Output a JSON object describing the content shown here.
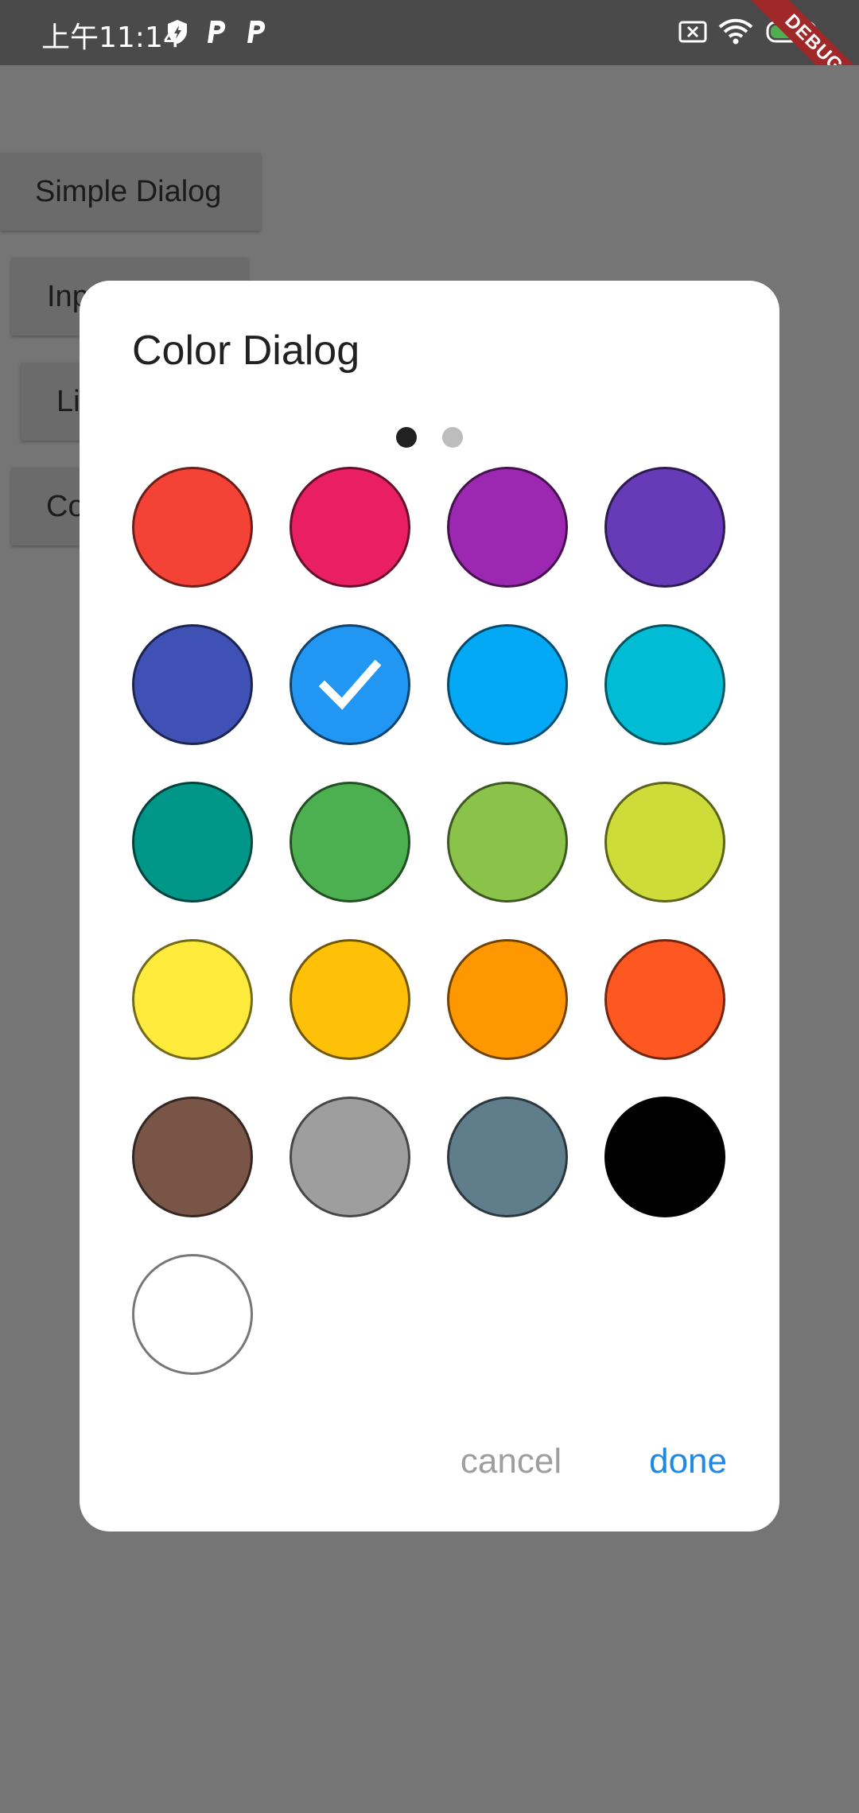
{
  "status_bar": {
    "time": "上午11:14",
    "debug_label": "DEBUG"
  },
  "background_buttons": [
    "Simple Dialog",
    "Inp",
    "Li",
    "Co"
  ],
  "dialog": {
    "title": "Color Dialog",
    "page_index": 1,
    "page_count": 2,
    "selected_index": 5,
    "swatches": [
      "#F44336",
      "#E91E63",
      "#9C27B0",
      "#673AB7",
      "#3F51B5",
      "#2196F3",
      "#03A9F4",
      "#00BCD4",
      "#009688",
      "#4CAF50",
      "#8BC34A",
      "#CDDC39",
      "#FFEB3B",
      "#FFC107",
      "#FF9800",
      "#FF5722",
      "#795548",
      "#9E9E9E",
      "#607D8B",
      "#000000",
      "#FFFFFF"
    ],
    "cancel_label": "cancel",
    "done_label": "done"
  }
}
